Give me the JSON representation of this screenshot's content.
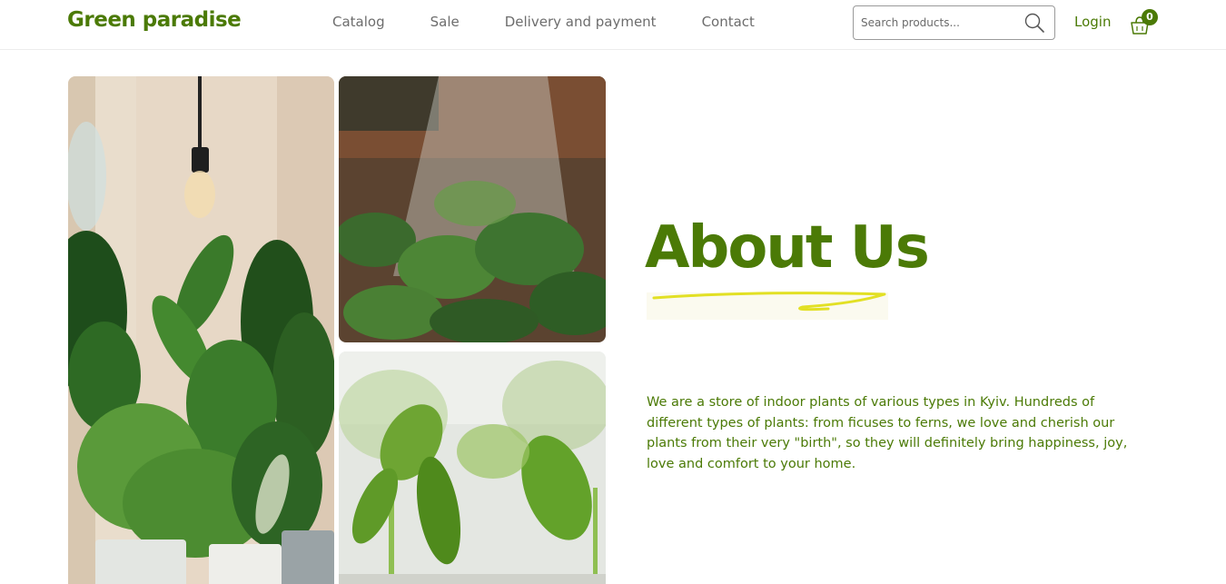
{
  "header": {
    "logo": "Green paradise",
    "nav": [
      {
        "label": "Catalog"
      },
      {
        "label": "Sale"
      },
      {
        "label": "Delivery and payment"
      },
      {
        "label": "Contact"
      }
    ],
    "search": {
      "placeholder": "Search products..."
    },
    "login_label": "Login",
    "cart_count": "0"
  },
  "hero": {
    "title": "About Us",
    "description": "We are a store of indoor plants of various types in Kyiv. Hundreds of different types of plants: from ficuses to ferns, we love and cherish our plants from their very \"birth\", so they will definitely bring happiness, joy, love and comfort to your home."
  },
  "colors": {
    "brand": "#4b7a06",
    "accent_underline": "#e2e024",
    "nav_text": "#6d6d6d"
  },
  "icons": {
    "search": "search-icon",
    "cart": "basket-icon"
  }
}
